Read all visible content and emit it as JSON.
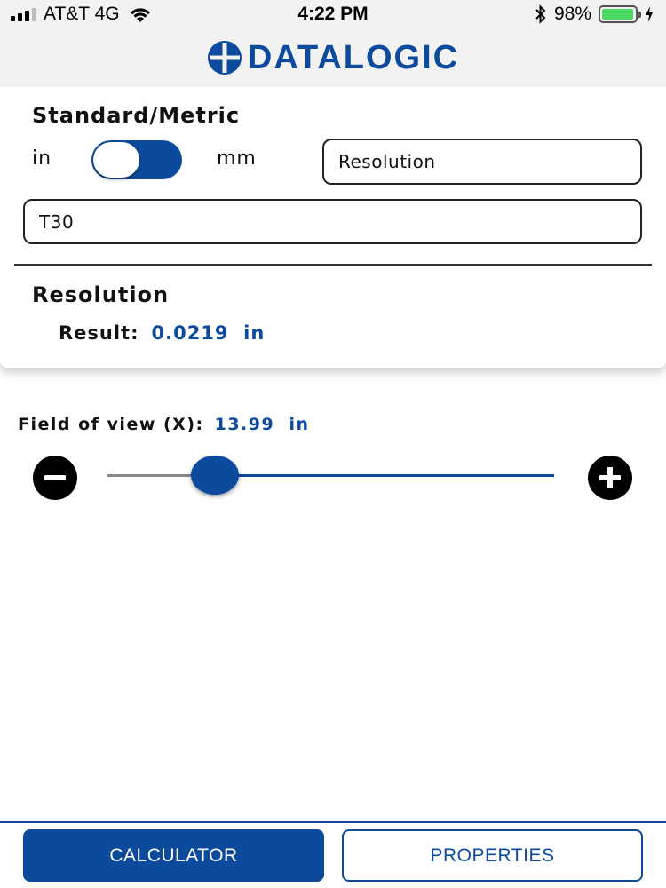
{
  "status_bar": {
    "carrier": "AT&T 4G",
    "time": "4:22 PM",
    "battery": "98%",
    "battery_level": 0.98
  },
  "header": {
    "brand": "DATALOGIC",
    "brand_color": "#0b4a9c"
  },
  "units": {
    "title": "Standard/Metric",
    "left_label": "in",
    "right_label": "mm",
    "toggle_on": true
  },
  "mode_field": {
    "value": "Resolution"
  },
  "model_field": {
    "value": "T30"
  },
  "result_section": {
    "title": "Resolution",
    "label": "Result:",
    "value": "0.0219",
    "unit": "in"
  },
  "field_of_view": {
    "label": "Field of view (X):",
    "value": "13.99",
    "unit": "in",
    "slider_fraction": 0.24
  },
  "tabs": {
    "calculator": "CALCULATOR",
    "properties": "PROPERTIES",
    "active": "calculator"
  },
  "icons": {
    "wifi": "wifi-icon",
    "bluetooth": "bluetooth-icon",
    "battery": "battery-icon",
    "charging": "charging-icon",
    "minus": "minus-icon",
    "plus": "plus-icon",
    "logo": "datalogic-logo-icon"
  }
}
